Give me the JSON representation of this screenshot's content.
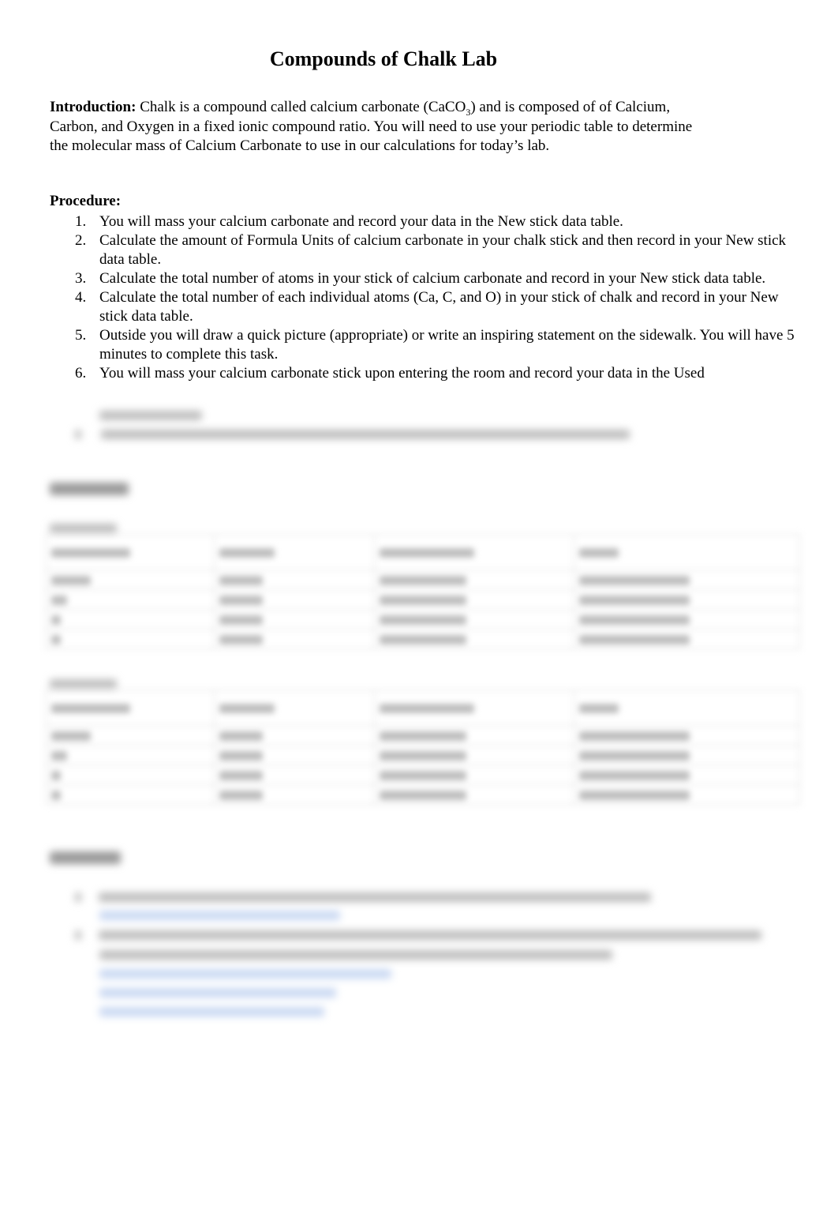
{
  "document": {
    "title": "Compounds of Chalk Lab",
    "introduction": {
      "label": "Introduction:",
      "text_before_sub": " Chalk is a compound called calcium carbonate (CaCO",
      "subscript": "3",
      "text_after_sub": ") and is composed of of Calcium, Carbon, and Oxygen in a fixed ionic compound ratio.  You will need to use your periodic table to determine the molecular mass of Calcium Carbonate to use in our calculations for today’s lab."
    },
    "procedure": {
      "heading": "Procedure:",
      "steps": [
        {
          "num": "1.",
          "text": "You will mass your calcium carbonate and record your data in the New stick data table."
        },
        {
          "num": "2.",
          "text": "Calculate the amount of Formula Units of calcium carbonate in your chalk stick and then record in your New stick data table."
        },
        {
          "num": "3.",
          "text": "Calculate the total number of atoms in your stick of calcium carbonate and record in your New stick data table."
        },
        {
          "num": "4.",
          "text": "Calculate the total number of each individual atoms (Ca, C, and O) in your stick of chalk and record in your New stick data table."
        },
        {
          "num": "5.",
          "text": "Outside you will draw a quick picture (appropriate) or write an inspiring statement on the sidewalk.  You will have 5 minutes to complete this task."
        },
        {
          "num": "6.",
          "text": "You will mass your calcium carbonate stick upon entering the room and record your data in the Used"
        }
      ]
    },
    "obscured_note": "Remaining content (step 7, data tables, questions) is blurred and unreadable"
  }
}
